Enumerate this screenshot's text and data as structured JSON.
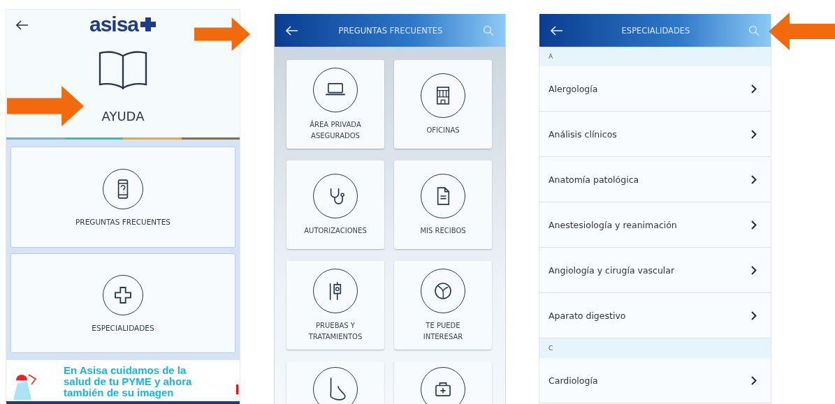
{
  "help_screen": {
    "logo": "asisa",
    "title": "AYUDA",
    "cards": [
      {
        "label": "PREGUNTAS FRECUENTES"
      },
      {
        "label": "ESPECIALIDADES"
      }
    ],
    "banner": "En Asisa cuidamos de la salud de tu PYME y ahora también de su imagen"
  },
  "faq_screen": {
    "title": "PREGUNTAS FRECUENTES",
    "cards": [
      {
        "kind": "full",
        "label": "ÁREA PRIVADA ASEGURADOS"
      },
      {
        "kind": "full",
        "label": "OFICINAS"
      },
      {
        "kind": "full",
        "label": "AUTORIZACIONES"
      },
      {
        "kind": "full",
        "label": "MIS RECIBOS"
      },
      {
        "kind": "full",
        "label": "PRUEBAS Y TRATAMIENTOS"
      },
      {
        "kind": "full",
        "label": "TE PUEDE INTERESAR"
      },
      {
        "kind": "cut_off"
      },
      {
        "kind": "cut_off"
      }
    ]
  },
  "specialties_screen": {
    "title": "ESPECIALIDADES",
    "sections": [
      {
        "letter": "A",
        "items": [
          "Alergología",
          "Análisis clínicos",
          "Anatomía patológica",
          "Anestesiología y reanimación",
          "Angiología y cirugía vascular",
          "Aparato digestivo"
        ]
      },
      {
        "letter": "C",
        "items": [
          "Cardiología"
        ]
      }
    ]
  }
}
